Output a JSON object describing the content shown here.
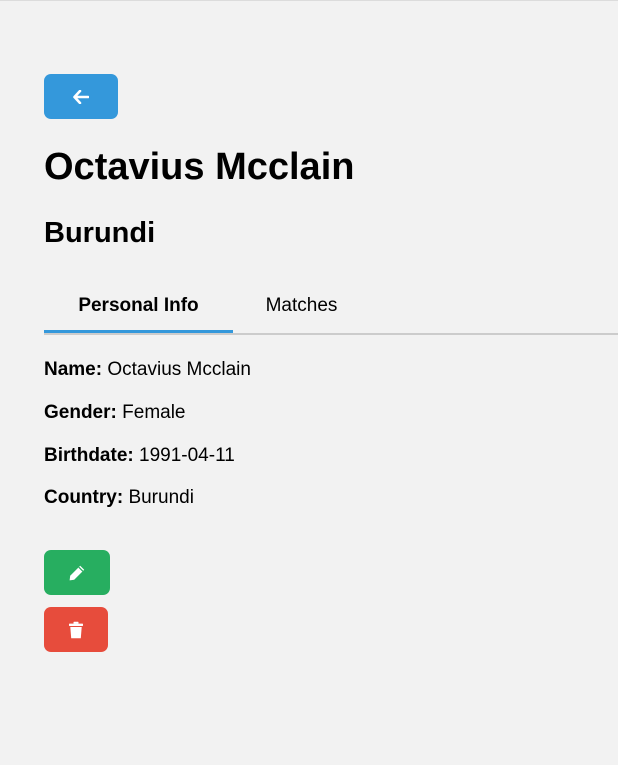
{
  "header": {
    "back_icon": "arrow-left-icon"
  },
  "player": {
    "name": "Octavius Mcclain",
    "country": "Burundi"
  },
  "tabs": [
    {
      "label": "Personal Info",
      "active": true
    },
    {
      "label": "Matches",
      "active": false
    }
  ],
  "personal_info": {
    "name_label": "Name:",
    "name_value": "Octavius Mcclain",
    "gender_label": "Gender:",
    "gender_value": "Female",
    "birthdate_label": "Birthdate:",
    "birthdate_value": "1991-04-11",
    "country_label": "Country:",
    "country_value": "Burundi"
  },
  "actions": {
    "edit_icon": "pencil-icon",
    "delete_icon": "trash-icon"
  },
  "colors": {
    "primary": "#3498db",
    "edit": "#27ae60",
    "delete": "#e74c3c",
    "background": "#f2f2f2"
  }
}
